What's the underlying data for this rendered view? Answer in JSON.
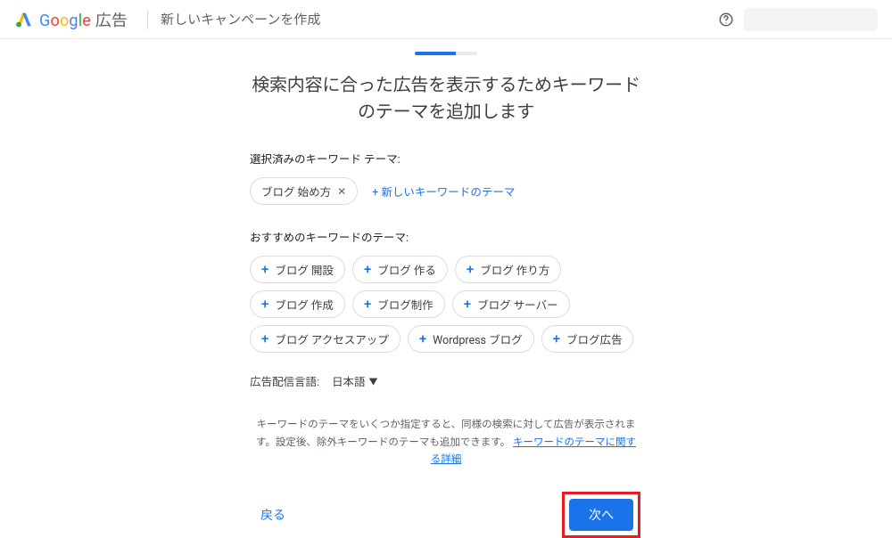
{
  "header": {
    "product": "Google",
    "product_suffix": "広告",
    "title": "新しいキャンペーンを作成"
  },
  "heading": "検索内容に合った広告を表示するためキーワードのテーマを追加します",
  "selected": {
    "label": "選択済みのキーワード テーマ:",
    "chips": [
      "ブログ 始め方"
    ],
    "add_link": "+ 新しいキーワードのテーマ"
  },
  "suggested": {
    "label": "おすすめのキーワードのテーマ:",
    "chips": [
      "ブログ 開設",
      "ブログ 作る",
      "ブログ 作り方",
      "ブログ 作成",
      "ブログ制作",
      "ブログ サーバー",
      "ブログ アクセスアップ",
      "Wordpress ブログ",
      "ブログ広告"
    ]
  },
  "language": {
    "label": "広告配信言語:",
    "value": "日本語"
  },
  "note": {
    "text": "キーワードのテーマをいくつか指定すると、同様の検索に対して広告が表示されます。設定後、除外キーワードのテーマも追加できます。",
    "link": "キーワードのテーマに関する詳細"
  },
  "footer": {
    "back": "戻る",
    "next": "次へ"
  }
}
